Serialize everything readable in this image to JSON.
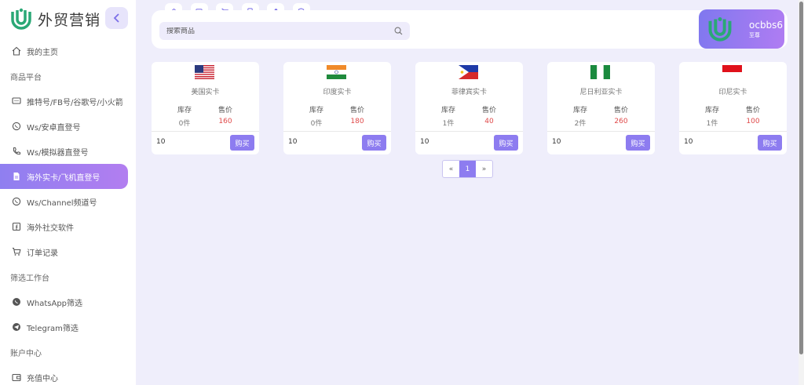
{
  "brand": {
    "name": "外贸营销"
  },
  "nav": {
    "home": "我的主页",
    "section_products": "商品平台",
    "item_twitter": "推特号/FB号/谷歌号/小火箭",
    "item_ws_android": "Ws/安卓直登号",
    "item_ws_emulator": "Ws/模拟器直登号",
    "item_overseas_card": "海外实卡/飞机直登号",
    "item_ws_channel": "Ws/Channel频道号",
    "item_social_software": "海外社交软件",
    "item_orders": "订单记录",
    "section_filter": "筛选工作台",
    "item_whatsapp_filter": "WhatsApp筛选",
    "item_telegram_filter": "Telegram筛选",
    "section_account": "账户中心",
    "item_recharge": "充值中心"
  },
  "search": {
    "placeholder": "搜索商品"
  },
  "user": {
    "name": "ocbbs6",
    "level": "至尊"
  },
  "labels": {
    "stock": "库存",
    "price": "售价",
    "buy": "购买"
  },
  "products": [
    {
      "title": "美国实卡",
      "stock": "0件",
      "price": "160",
      "qty": "10",
      "flag": "us-flag-icon"
    },
    {
      "title": "印度实卡",
      "stock": "0件",
      "price": "180",
      "qty": "10",
      "flag": "india-flag-icon"
    },
    {
      "title": "菲律宾实卡",
      "stock": "1件",
      "price": "40",
      "qty": "10",
      "flag": "philippines-flag-icon"
    },
    {
      "title": "尼日利亚实卡",
      "stock": "2件",
      "price": "260",
      "qty": "10",
      "flag": "nigeria-flag-icon"
    },
    {
      "title": "印尼实卡",
      "stock": "1件",
      "price": "100",
      "qty": "10",
      "flag": "indonesia-flag-icon"
    }
  ],
  "pagination": {
    "prev": "«",
    "current": "1",
    "next": "»"
  },
  "colors": {
    "accent": "#8d7cf0",
    "price": "#e04a4a",
    "logo": "#2aa876"
  }
}
